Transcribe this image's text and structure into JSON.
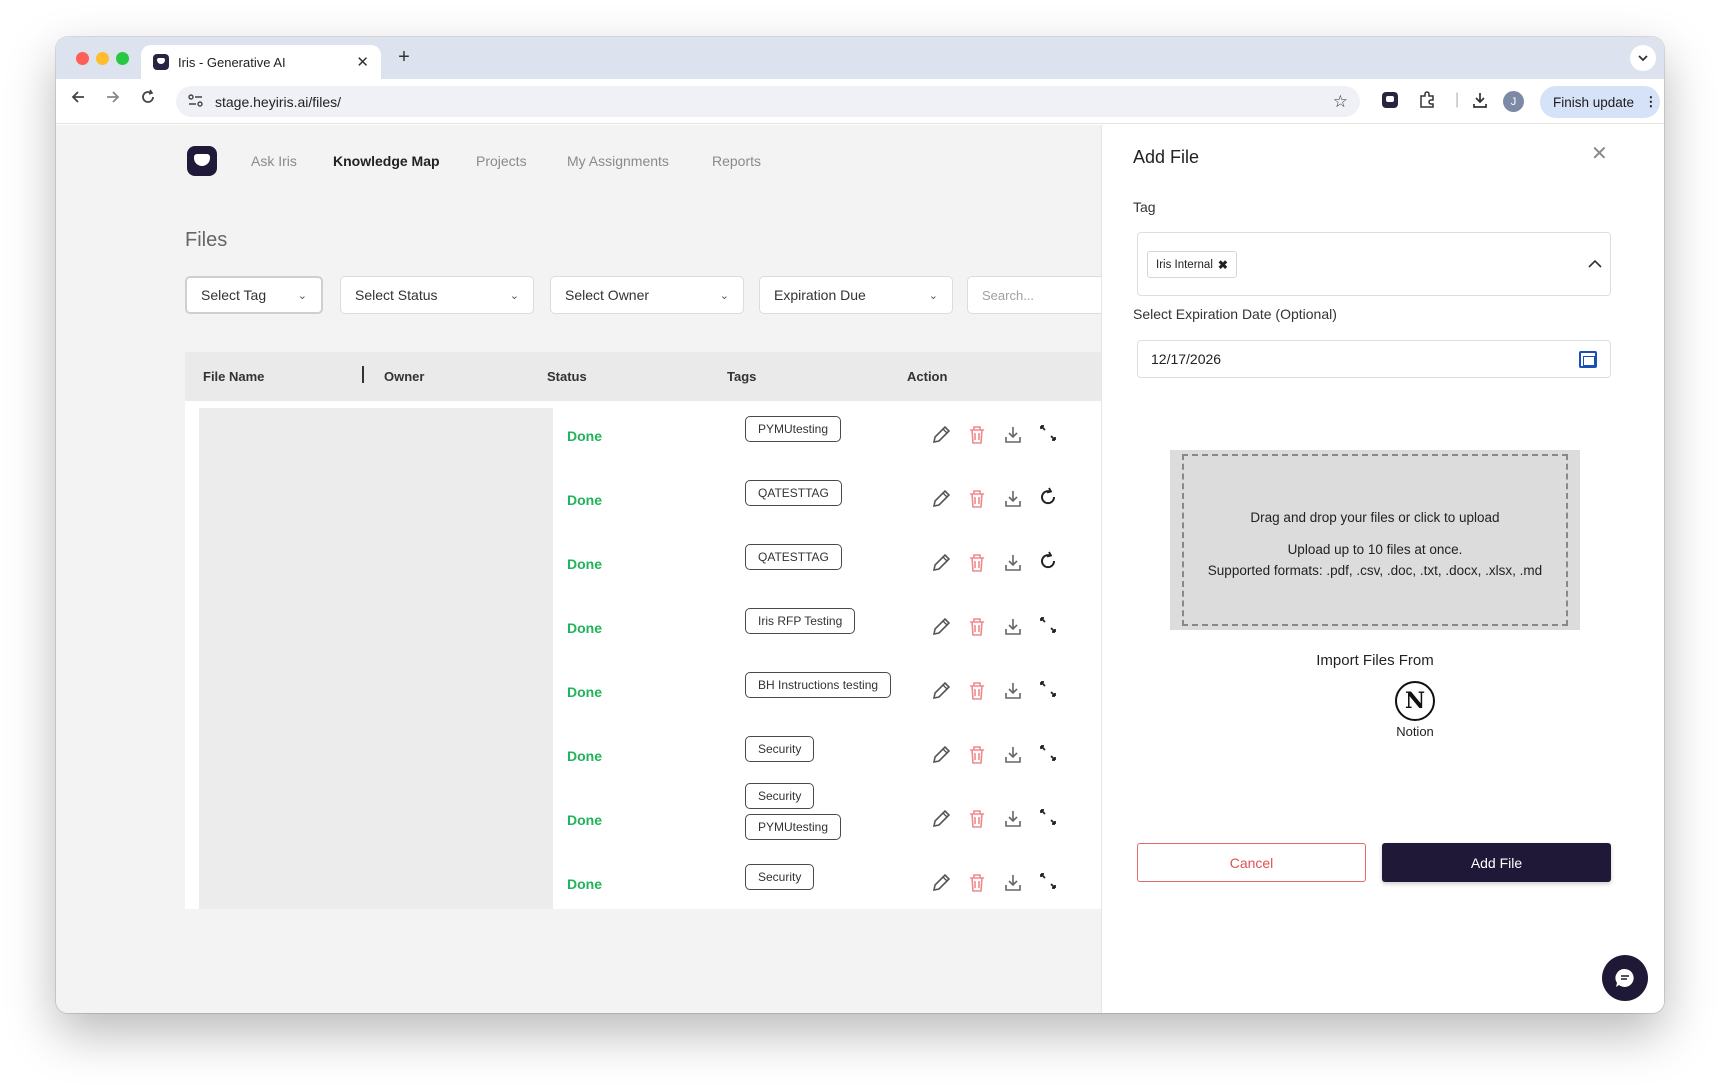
{
  "browser": {
    "tab_title": "Iris - Generative AI",
    "tab_close": "✕",
    "new_tab": "+",
    "url": "stage.heyiris.ai/files/",
    "profile_initial": "J",
    "finish_update": "Finish update"
  },
  "nav": {
    "items": [
      "Ask Iris",
      "Knowledge Map",
      "Projects",
      "My Assignments",
      "Reports"
    ],
    "active": "Knowledge Map"
  },
  "page": {
    "title": "Files",
    "filters": [
      "Select Tag",
      "Select Status",
      "Select Owner",
      "Expiration Due"
    ],
    "search_placeholder": "Search..."
  },
  "table": {
    "columns": [
      "File Name",
      "Owner",
      "Status",
      "Tags",
      "Action"
    ],
    "rows": [
      {
        "status": "Done",
        "tags": [
          "PYMUtesting"
        ],
        "extra_action": "expand-icon"
      },
      {
        "status": "Done",
        "tags": [
          "QATESTTAG"
        ],
        "extra_action": "refresh-icon"
      },
      {
        "status": "Done",
        "tags": [
          "QATESTTAG"
        ],
        "extra_action": "refresh-icon"
      },
      {
        "status": "Done",
        "tags": [
          "Iris RFP Testing"
        ],
        "extra_action": "expand-icon"
      },
      {
        "status": "Done",
        "tags": [
          "BH Instructions testing"
        ],
        "extra_action": "expand-icon"
      },
      {
        "status": "Done",
        "tags": [
          "Security"
        ],
        "extra_action": "expand-icon"
      },
      {
        "status": "Done",
        "tags": [
          "Security",
          "PYMUtesting"
        ],
        "extra_action": "expand-icon"
      },
      {
        "status": "Done",
        "tags": [
          "Security"
        ],
        "extra_action": "expand-icon"
      }
    ],
    "status_color": "#1fb45a"
  },
  "panel": {
    "title": "Add File",
    "close": "✕",
    "tag_label": "Tag",
    "selected_tag": "Iris Internal",
    "chip_remove": "✖",
    "date_label": "Select Expiration Date (Optional)",
    "date_value": "12/17/2026",
    "dropzone": {
      "line1": "Drag and drop your files or click to upload",
      "line2": "Upload up to 10 files at once.",
      "line3": "Supported formats: .pdf, .csv, .doc, .txt, .docx, .xlsx, .md"
    },
    "import_title": "Import Files From",
    "import_source": "Notion",
    "cancel_label": "Cancel",
    "add_label": "Add File"
  },
  "colors": {
    "brand": "#1f1937",
    "cancel": "#e05252",
    "delete_icon": "#f08a8a"
  }
}
